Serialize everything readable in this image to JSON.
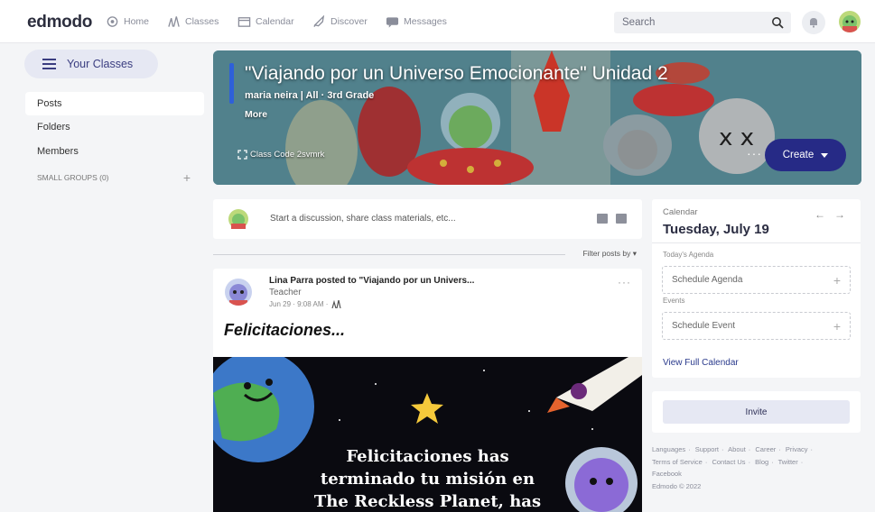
{
  "brand": {
    "logo": "edmodo"
  },
  "nav": {
    "items": [
      {
        "label": "Home",
        "icon": "home-icon"
      },
      {
        "label": "Classes",
        "icon": "classes-icon"
      },
      {
        "label": "Calendar",
        "icon": "calendar-icon"
      },
      {
        "label": "Discover",
        "icon": "rocket-icon"
      },
      {
        "label": "Messages",
        "icon": "messages-icon"
      }
    ],
    "search_placeholder": "Search"
  },
  "sidebar": {
    "your_classes": "Your Classes",
    "items": [
      {
        "label": "Posts",
        "active": true
      },
      {
        "label": "Folders",
        "active": false
      },
      {
        "label": "Members",
        "active": false
      }
    ],
    "small_groups": "SMALL GROUPS (0)"
  },
  "banner": {
    "title": "\"Viajando por un Universo Emocionante\" Unidad 2",
    "subtitle": "maria neira | All · 3rd Grade",
    "more": "More",
    "class_code": "Class Code 2svmrk",
    "create": "Create"
  },
  "composer": {
    "placeholder": "Start a discussion, share class materials, etc..."
  },
  "filter": {
    "label": "Filter posts by"
  },
  "post": {
    "author": "Lina Parra posted to \"Viajando por un Univers...",
    "role": "Teacher",
    "time": "Jun 29 · 9:08 AM ·",
    "heading": "Felicitaciones...",
    "image_lines": [
      "Felicitaciones has",
      "terminado tu misión en",
      "The Reckless Planet, has"
    ]
  },
  "calendar": {
    "label": "Calendar",
    "date": "Tuesday, July 19",
    "agenda_label": "Today's Agenda",
    "schedule_agenda": "Schedule Agenda",
    "events_label": "Events",
    "schedule_event": "Schedule Event",
    "view_full": "View Full Calendar"
  },
  "invite": {
    "label": "Invite"
  },
  "footer": {
    "links": [
      "Languages",
      "Support",
      "About",
      "Career",
      "Privacy",
      "Terms of Service",
      "Contact Us",
      "Blog",
      "Twitter",
      "Facebook"
    ],
    "copyright": "Edmodo © 2022"
  },
  "colors": {
    "accent": "#262a86",
    "soft_accent": "#e6e8f3",
    "link": "#2a3a8c"
  }
}
